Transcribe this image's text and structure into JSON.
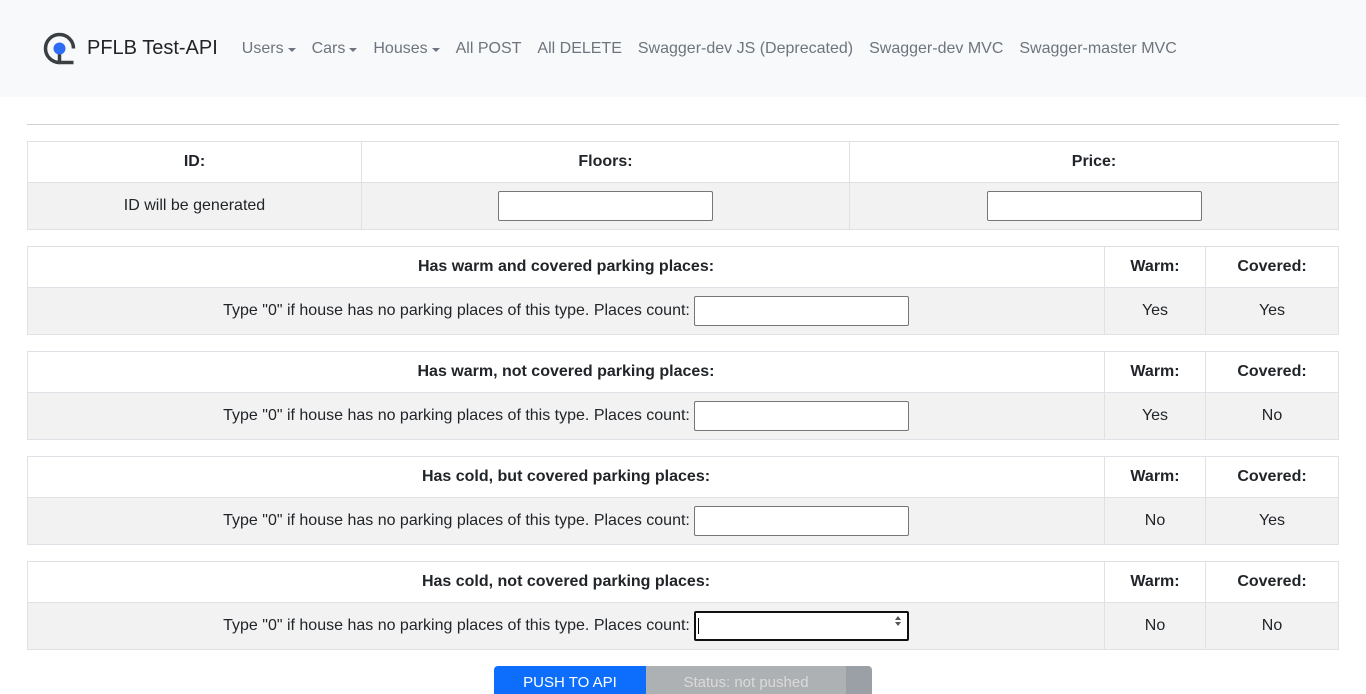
{
  "navbar": {
    "brand": "PFLB Test-API",
    "links": [
      {
        "label": "Users",
        "dropdown": true
      },
      {
        "label": "Cars",
        "dropdown": true
      },
      {
        "label": "Houses",
        "dropdown": true
      },
      {
        "label": "All POST",
        "dropdown": false
      },
      {
        "label": "All DELETE",
        "dropdown": false
      },
      {
        "label": "Swagger-dev JS (Deprecated)",
        "dropdown": false
      },
      {
        "label": "Swagger-dev MVC",
        "dropdown": false
      },
      {
        "label": "Swagger-master MVC",
        "dropdown": false
      }
    ]
  },
  "main_table": {
    "headers": [
      "ID:",
      "Floors:",
      "Price:"
    ],
    "id_value": "ID will be generated",
    "floors_value": "",
    "price_value": ""
  },
  "parking": [
    {
      "title": "Has warm and covered parking places:",
      "warm_header": "Warm:",
      "covered_header": "Covered:",
      "prompt": "Type \"0\" if house has no parking places of this type. Places count:",
      "value": "",
      "warm": "Yes",
      "covered": "Yes"
    },
    {
      "title": "Has warm, not covered parking places:",
      "warm_header": "Warm:",
      "covered_header": "Covered:",
      "prompt": "Type \"0\" if house has no parking places of this type. Places count:",
      "value": "",
      "warm": "Yes",
      "covered": "No"
    },
    {
      "title": "Has cold, but covered parking places:",
      "warm_header": "Warm:",
      "covered_header": "Covered:",
      "prompt": "Type \"0\" if house has no parking places of this type. Places count:",
      "value": "",
      "warm": "No",
      "covered": "Yes"
    },
    {
      "title": "Has cold, not covered parking places:",
      "warm_header": "Warm:",
      "covered_header": "Covered:",
      "prompt": "Type \"0\" if house has no parking places of this type. Places count:",
      "value": "",
      "warm": "No",
      "covered": "No"
    }
  ],
  "buttons": {
    "push": "PUSH TO API",
    "status": "Status: not pushed"
  },
  "colors": {
    "primary": "#0d6efd",
    "navbar_bg": "#f8f9fa",
    "row_bg": "#f2f2f2"
  }
}
